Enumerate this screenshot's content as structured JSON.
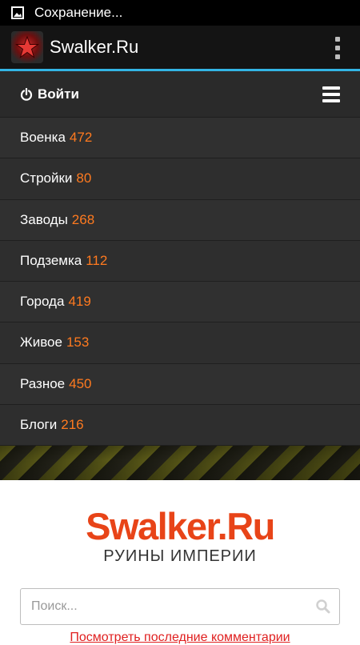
{
  "status_bar": {
    "notification_text": "Сохранение..."
  },
  "action_bar": {
    "title": "Swalker.Ru"
  },
  "menu": {
    "login_label": "Войти",
    "items": [
      {
        "label": "Военка",
        "count": "472"
      },
      {
        "label": "Стройки",
        "count": "80"
      },
      {
        "label": "Заводы",
        "count": "268"
      },
      {
        "label": "Подземка",
        "count": "112"
      },
      {
        "label": "Города",
        "count": "419"
      },
      {
        "label": "Живое",
        "count": "153"
      },
      {
        "label": "Разное",
        "count": "450"
      },
      {
        "label": "Блоги",
        "count": "216"
      }
    ]
  },
  "site": {
    "brand_title": "Swalker.Ru",
    "brand_subtitle": "РУИНЫ ИМПЕРИИ",
    "search_placeholder": "Поиск...",
    "comments_link": "Посмотреть последние комментарии"
  },
  "colors": {
    "accent_blue": "#33b5e5",
    "count_orange": "#ff7a1f",
    "brand_red": "#e84418"
  }
}
